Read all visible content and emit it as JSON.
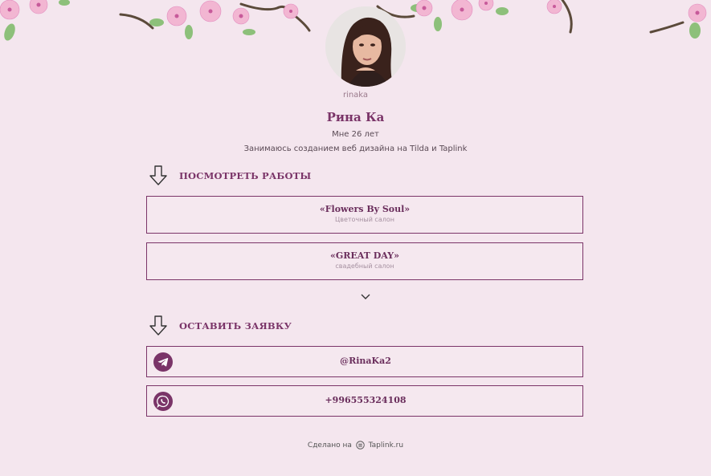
{
  "profile": {
    "username": "rinaka",
    "name": "Рина Ка",
    "bio_line1": "Мне 26 лет",
    "bio_line2": "Занимаюсь созданием веб дизайна на Tilda и Taplink"
  },
  "sections": {
    "works_title": "ПОСМОТРЕТЬ РАБОТЫ",
    "request_title": "ОСТАВИТЬ ЗАЯВКУ"
  },
  "works": [
    {
      "title": "«Flowers By Soul»",
      "subtitle": "Цветочный салон"
    },
    {
      "title": "«GREAT DAY»",
      "subtitle": "свадебный салон"
    }
  ],
  "contacts": [
    {
      "label": "@RinaKa2",
      "icon": "telegram-icon"
    },
    {
      "label": "+996555324108",
      "icon": "whatsapp-icon"
    }
  ],
  "footer": {
    "prefix": "Сделано на",
    "brand": "Taplink.ru"
  },
  "colors": {
    "background": "#f4e6ee",
    "accent": "#7a3468"
  }
}
